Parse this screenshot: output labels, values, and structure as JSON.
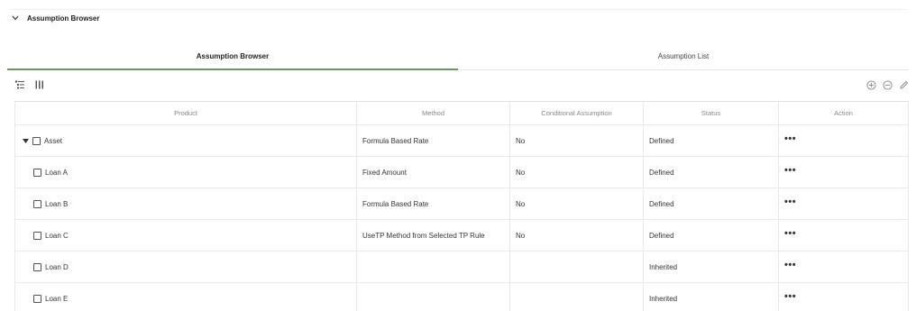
{
  "section": {
    "title": "Assumption Browser"
  },
  "tabs": [
    {
      "label": "Assumption Browser",
      "active": true
    },
    {
      "label": "Assumption List",
      "active": false
    }
  ],
  "toolbar": {
    "left_icons": [
      "expand-tree-icon",
      "columns-icon"
    ],
    "right_icons": [
      "add-circle-icon",
      "remove-circle-icon",
      "edit-pencil-icon"
    ]
  },
  "table": {
    "columns": [
      "Product",
      "Method",
      "Conditional Assumption",
      "Status",
      "Action"
    ],
    "rows": [
      {
        "product": "Asset",
        "method": "Formula Based Rate",
        "conditional": "No",
        "status": "Defined",
        "action": "•••",
        "level": 0,
        "expandable": true
      },
      {
        "product": "Loan A",
        "method": "Fixed Amount",
        "conditional": "No",
        "status": "Defined",
        "action": "•••",
        "level": 1
      },
      {
        "product": "Loan B",
        "method": "Formula Based Rate",
        "conditional": "No",
        "status": "Defined",
        "action": "•••",
        "level": 1
      },
      {
        "product": "Loan C",
        "method": "UseTP Method from Selected TP Rule",
        "conditional": "No",
        "status": "Defined",
        "action": "•••",
        "level": 1
      },
      {
        "product": "Loan D",
        "method": "",
        "conditional": "",
        "status": "Inherited",
        "action": "•••",
        "level": 1
      },
      {
        "product": "Loan E",
        "method": "",
        "conditional": "",
        "status": "Inherited",
        "action": "•••",
        "level": 1
      }
    ]
  },
  "colors": {
    "active_tab_underline": "#6f8f65",
    "grid_line": "#e8e8e8"
  }
}
